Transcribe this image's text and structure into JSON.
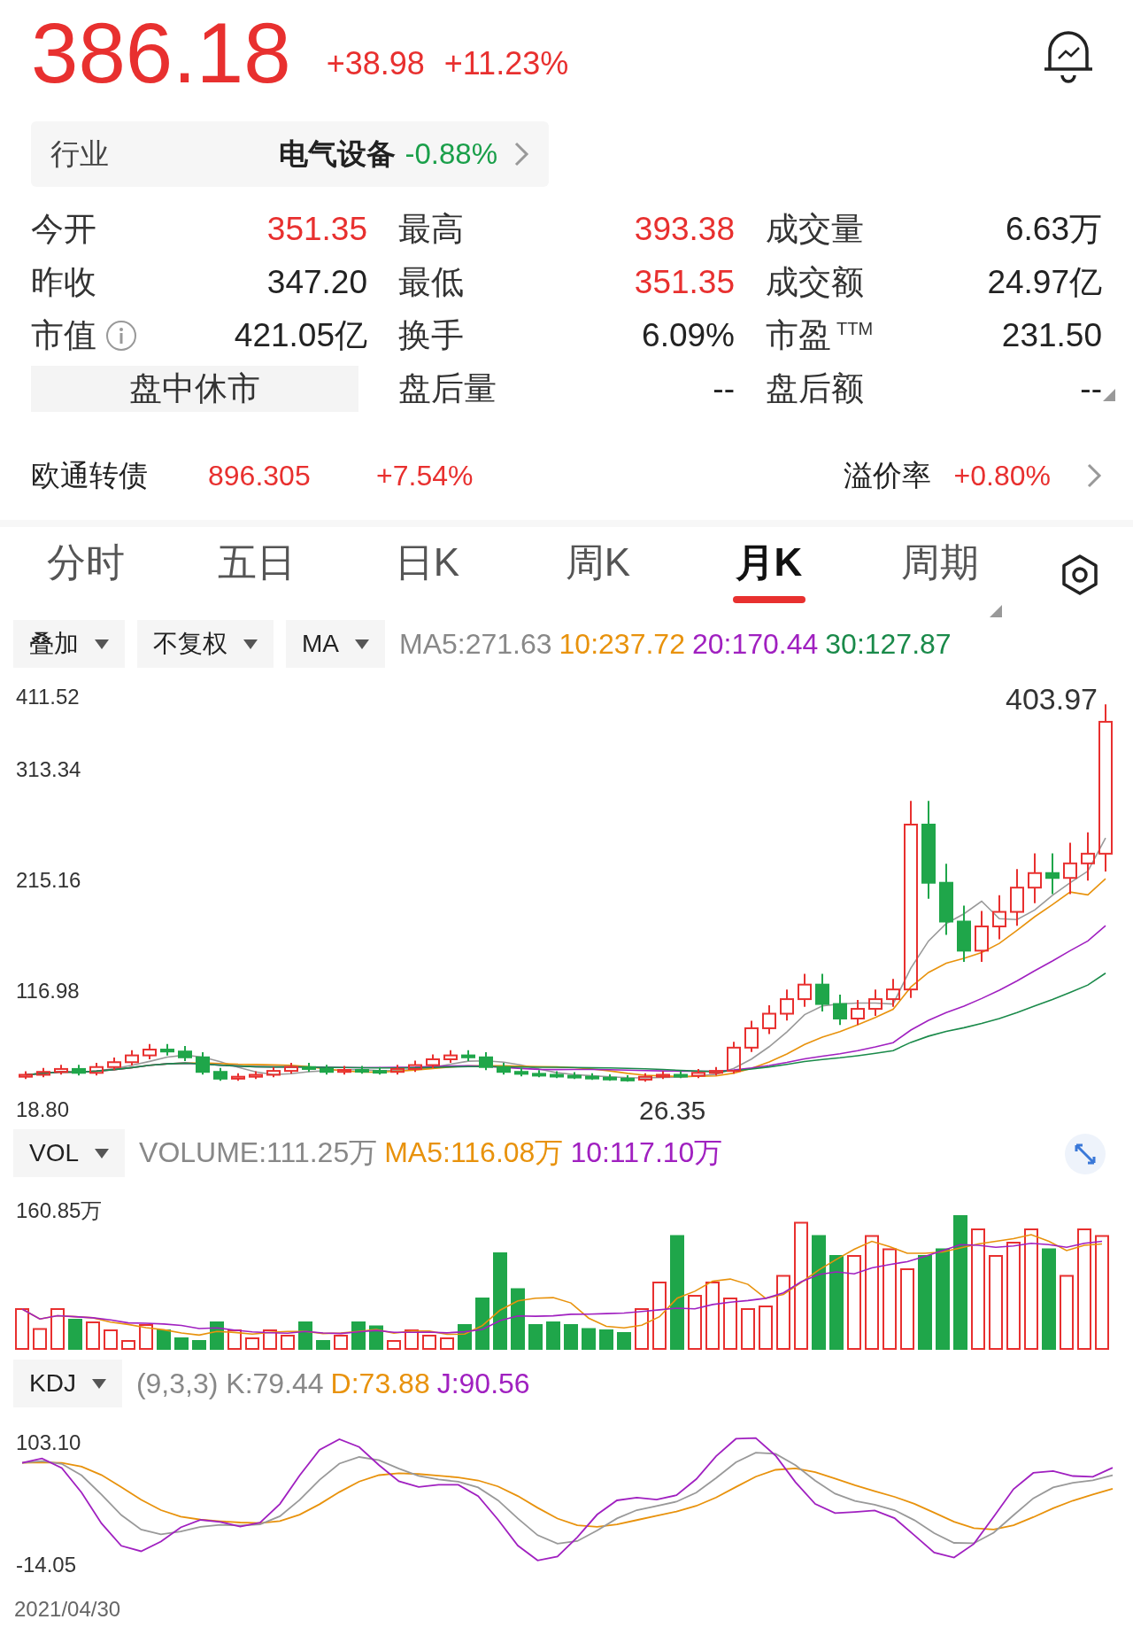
{
  "quote": {
    "price": "386.18",
    "change": "+38.98",
    "change_pct": "+11.23%"
  },
  "industry": {
    "label": "行业",
    "name": "电气设备",
    "change": "-0.88%",
    "color": "#1a9f4a"
  },
  "stats": [
    [
      {
        "kind": "plain",
        "label": "今开",
        "value": "351.35",
        "color": "#e8302f"
      },
      {
        "kind": "plain",
        "label": "最高",
        "value": "393.38",
        "color": "#e8302f"
      },
      {
        "kind": "plain",
        "label": "成交量",
        "value": "6.63万",
        "color": "#222222"
      }
    ],
    [
      {
        "kind": "plain",
        "label": "昨收",
        "value": "347.20",
        "color": "#222222"
      },
      {
        "kind": "plain",
        "label": "最低",
        "value": "351.35",
        "color": "#e8302f"
      },
      {
        "kind": "plain",
        "label": "成交额",
        "value": "24.97亿",
        "color": "#222222"
      }
    ],
    [
      {
        "kind": "info",
        "label": "市值",
        "value": "421.05亿",
        "color": "#222222"
      },
      {
        "kind": "plain",
        "label": "换手",
        "value": "6.09%",
        "color": "#222222"
      },
      {
        "kind": "plain",
        "label": "市盈$^{TTM}$",
        "value": "231.50",
        "color": "#222222"
      }
    ],
    [
      {
        "kind": "status",
        "label": "盘中休市"
      },
      {
        "kind": "plain",
        "label": "盘后量",
        "value": "--",
        "color": "#222222"
      },
      {
        "kind": "plain",
        "label": "盘后额",
        "value": "--",
        "color": "#222222"
      }
    ]
  ],
  "convertible_bond": {
    "label": "欧通转债",
    "price": "896.305",
    "change": "+7.54%",
    "premium_label": "溢价率",
    "premium": "+0.80%"
  },
  "tabs": [
    {
      "label": "分时",
      "selected": false
    },
    {
      "label": "五日",
      "selected": false
    },
    {
      "label": "日K",
      "selected": false
    },
    {
      "label": "周K",
      "selected": false
    },
    {
      "label": "月K",
      "selected": true
    },
    {
      "label": "周期",
      "selected": false
    }
  ],
  "toolbar": {
    "dropdowns": [
      "叠加",
      "不复权",
      "MA"
    ],
    "ma_legend": [
      {
        "text": "MA5:271.63",
        "color": "#888888"
      },
      {
        "text": "10:237.72",
        "color": "#e8920c"
      },
      {
        "text": "20:170.44",
        "color": "#a020c0"
      },
      {
        "text": "30:127.87",
        "color": "#1a8a4a"
      }
    ]
  },
  "kline": {
    "y_labels": [
      "411.52",
      "313.34",
      "215.16",
      "116.98",
      "18.80"
    ],
    "high_label": "403.97",
    "low_label": "26.35"
  },
  "volume": {
    "dropdown": "VOL",
    "legend": [
      {
        "text": "VOLUME:111.25万",
        "color": "#888888"
      },
      {
        "text": "MA5:116.08万",
        "color": "#e8920c"
      },
      {
        "text": "10:117.10万",
        "color": "#a020c0"
      }
    ],
    "y_label": "160.85万"
  },
  "kdj": {
    "dropdown": "KDJ",
    "legend": [
      {
        "text": "(9,3,3) K:79.44",
        "color": "#888888"
      },
      {
        "text": "D:73.88",
        "color": "#e8920c"
      },
      {
        "text": "J:90.56",
        "color": "#a020c0"
      }
    ],
    "y_labels": [
      "103.10",
      "-14.05"
    ]
  },
  "date": "2021/04/30"
}
